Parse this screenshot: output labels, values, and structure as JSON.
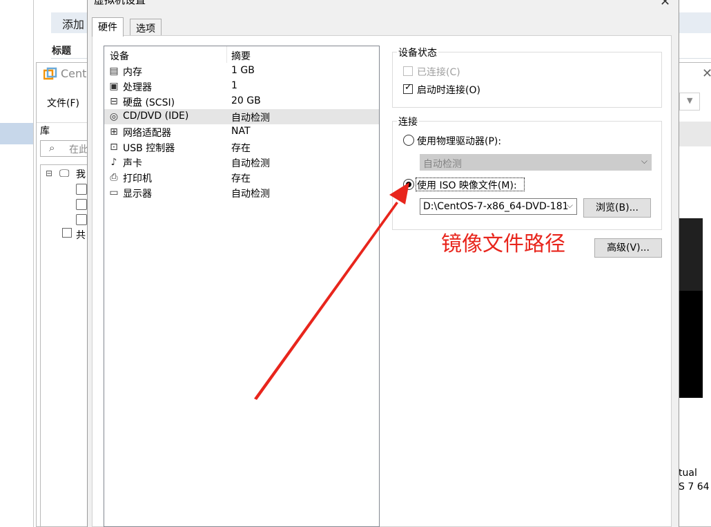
{
  "background": {
    "band_text": "添加",
    "section_label": "标题"
  },
  "vmware": {
    "title": "Cent",
    "menu_file": "文件(F)",
    "library_label": "库",
    "search_placeholder": "在此",
    "tree_items": [
      "我",
      "共"
    ],
    "right_text_1": "tual",
    "right_text_2": "S 7 64"
  },
  "dialog": {
    "title": "虚拟机设置",
    "tabs": [
      {
        "label": "硬件",
        "active": true
      },
      {
        "label": "选项",
        "active": false
      }
    ],
    "device_list": {
      "col_device": "设备",
      "col_summary": "摘要",
      "rows": [
        {
          "icon": "memory-icon",
          "name": "内存",
          "summary": "1 GB",
          "selected": false
        },
        {
          "icon": "processor-icon",
          "name": "处理器",
          "summary": "1",
          "selected": false
        },
        {
          "icon": "harddisk-icon",
          "name": "硬盘 (SCSI)",
          "summary": "20 GB",
          "selected": false
        },
        {
          "icon": "cd-dvd-icon",
          "name": "CD/DVD (IDE)",
          "summary": "自动检测",
          "selected": true
        },
        {
          "icon": "network-adapter-icon",
          "name": "网络适配器",
          "summary": "NAT",
          "selected": false
        },
        {
          "icon": "usb-icon",
          "name": "USB 控制器",
          "summary": "存在",
          "selected": false
        },
        {
          "icon": "sound-card-icon",
          "name": "声卡",
          "summary": "自动检测",
          "selected": false
        },
        {
          "icon": "printer-icon",
          "name": "打印机",
          "summary": "存在",
          "selected": false
        },
        {
          "icon": "display-icon",
          "name": "显示器",
          "summary": "自动检测",
          "selected": false
        }
      ]
    },
    "device_status": {
      "title": "设备状态",
      "connected_label": "已连接(C)",
      "connected_checked": false,
      "connected_enabled": false,
      "connect_at_poweron_label": "启动时连接(O)",
      "connect_at_poweron_checked": true
    },
    "connection": {
      "title": "连接",
      "physical_drive_label": "使用物理驱动器(P):",
      "physical_drive_selected": false,
      "physical_drive_value": "自动检测",
      "iso_label": "使用 ISO 映像文件(M):",
      "iso_selected": true,
      "iso_path": "D:\\CentOS-7-x86_64-DVD-181",
      "browse_label": "浏览(B)..."
    },
    "advanced_label": "高级(V)..."
  },
  "annotation": {
    "text": "镜像文件路径",
    "color": "#e8251c"
  }
}
